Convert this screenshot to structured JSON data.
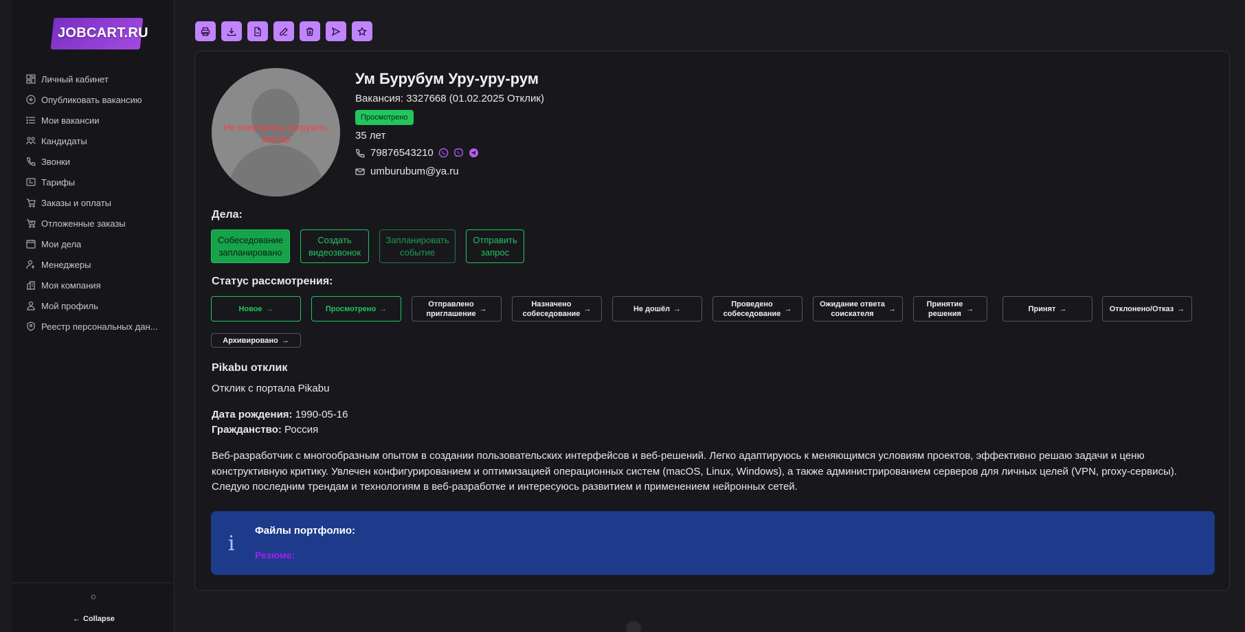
{
  "logo": {
    "text": "JOBCART.RU"
  },
  "sidebar": {
    "items": [
      {
        "label": "Личный кабинет",
        "icon": "dashboard-icon"
      },
      {
        "label": "Опубликовать вакансию",
        "icon": "plus-circle-icon"
      },
      {
        "label": "Мои вакансии",
        "icon": "list-icon"
      },
      {
        "label": "Кандидаты",
        "icon": "users-icon"
      },
      {
        "label": "Звонки",
        "icon": "phone-icon"
      },
      {
        "label": "Тарифы",
        "icon": "tariff-icon"
      },
      {
        "label": "Заказы и оплаты",
        "icon": "cart-icon"
      },
      {
        "label": "Отложенные заказы",
        "icon": "deferred-cart-icon"
      },
      {
        "label": "Мои дела",
        "icon": "calendar-icon"
      },
      {
        "label": "Менеджеры",
        "icon": "managers-icon"
      },
      {
        "label": "Моя компания",
        "icon": "building-icon"
      },
      {
        "label": "Мой профиль",
        "icon": "user-icon"
      },
      {
        "label": "Реестр персональных дан...",
        "icon": "shield-icon"
      }
    ],
    "collapse_label": "Collapse"
  },
  "toolbar": {
    "buttons": [
      "print-icon",
      "download-icon",
      "file-icon",
      "edit-icon",
      "trash-icon",
      "send-icon",
      "star-icon"
    ]
  },
  "candidate": {
    "avatar_error": "Не получилось загрузить аватар",
    "name": "Ум Бурубум Уру-уру-рум",
    "vacancy": "Вакансия: 3327668 (01.02.2025 Отклик)",
    "badge": "Просмотрено",
    "age": "35 лет",
    "phone": "79876543210",
    "email": "umburubum@ya.ru"
  },
  "deals": {
    "title": "Дела:",
    "buttons": [
      {
        "line1": "Собеседование",
        "line2": "запланировано"
      },
      {
        "line1": "Создать",
        "line2": "видеозвонок"
      },
      {
        "line1": "Запланировать",
        "line2": "событие"
      },
      {
        "line1": "Отправить",
        "line2": "запрос"
      }
    ]
  },
  "status": {
    "title": "Статус рассмотрения:",
    "buttons": [
      {
        "line1": "Новое",
        "line2": ""
      },
      {
        "line1": "Просмотрено",
        "line2": ""
      },
      {
        "line1": "Отправлено",
        "line2": "приглашение"
      },
      {
        "line1": "Назначено",
        "line2": "собеседование"
      },
      {
        "line1": "Не дошёл",
        "line2": ""
      },
      {
        "line1": "Проведено",
        "line2": "собеседование"
      },
      {
        "line1": "Ожидание ответа",
        "line2": "соискателя"
      },
      {
        "line1": "Принятие",
        "line2": "решения"
      },
      {
        "line1": "Принят",
        "line2": ""
      },
      {
        "line1": "Отклонено/Отказ",
        "line2": ""
      },
      {
        "line1": "Архивировано",
        "line2": ""
      }
    ],
    "arrow": "→"
  },
  "source": {
    "title": "Pikabu отклик",
    "text": "Отклик с портала Pikabu"
  },
  "details": {
    "birth_label": "Дата рождения:",
    "birth_value": "1990-05-16",
    "citizen_label": "Гражданство:",
    "citizen_value": "Россия"
  },
  "about": "Веб-разработчик с многообразным опытом в создании пользовательских интерфейсов и веб-решений. Легко адаптируюсь к меняющимся условиям проектов, эффективно решаю задачи и ценю конструктивную критику. Увлечен конфигурированием и оптимизацией операционных систем (macOS, Linux, Windows), а также администрированием серверов для личных целей (VPN, proxy-сервисы). Следую последним трендам и технологиям в веб-разработке и интересуюсь развитием и применением нейронных сетей.",
  "portfolio": {
    "title": "Файлы портфолио:",
    "resume_link": "Резюме:"
  },
  "colors": {
    "accent": "#c084fc",
    "green": "#22c55e",
    "info_bg": "#1e3a8a",
    "link": "#a020f0",
    "error": "#ff3b3b"
  }
}
